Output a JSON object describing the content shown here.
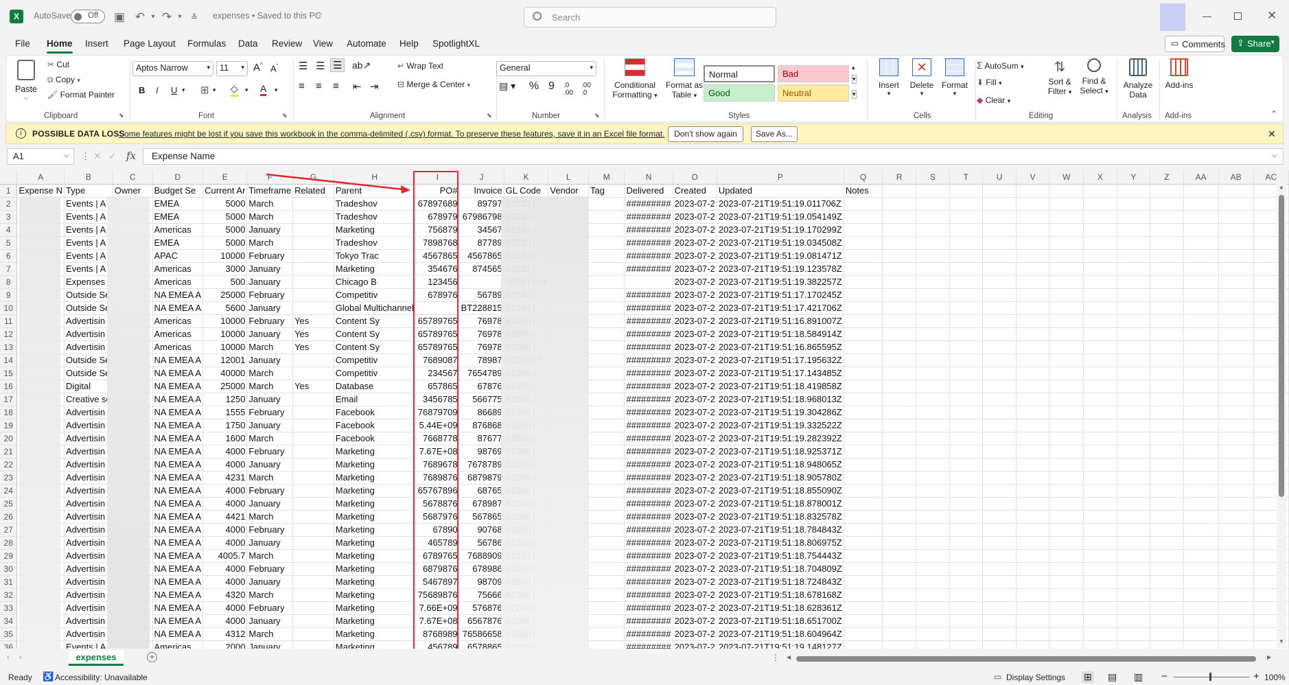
{
  "titlebar": {
    "autosave": "AutoSave",
    "toggle": "Off",
    "doc_title": "expenses • Saved to this PC",
    "search_placeholder": "Search"
  },
  "menu": [
    "File",
    "Home",
    "Insert",
    "Page Layout",
    "Formulas",
    "Data",
    "Review",
    "View",
    "Automate",
    "Help",
    "SpotlightXL"
  ],
  "menu_buttons": {
    "comments": "Comments",
    "share": "Share"
  },
  "ribbon": {
    "clipboard": {
      "paste": "Paste",
      "cut": "Cut",
      "copy": "Copy",
      "format_painter": "Format Painter",
      "group": "Clipboard"
    },
    "font": {
      "name": "Aptos Narrow",
      "size": "11",
      "group": "Font"
    },
    "alignment": {
      "wrap": "Wrap Text",
      "merge": "Merge & Center",
      "group": "Alignment"
    },
    "number": {
      "format": "General",
      "group": "Number"
    },
    "styles": {
      "cond1": "Conditional",
      "cond2": "Formatting",
      "fmt1": "Format as",
      "fmt2": "Table",
      "normal": "Normal",
      "bad": "Bad",
      "good": "Good",
      "neutral": "Neutral",
      "group": "Styles"
    },
    "cells": {
      "insert": "Insert",
      "delete": "Delete",
      "format": "Format",
      "group": "Cells"
    },
    "editing": {
      "autosum": "AutoSum",
      "fill": "Fill",
      "clear": "Clear",
      "sort1": "Sort &",
      "sort2": "Filter",
      "find1": "Find &",
      "find2": "Select",
      "group": "Editing"
    },
    "analysis": {
      "l1": "Analyze",
      "l2": "Data",
      "group": "Analysis"
    },
    "addins": {
      "label": "Add-ins",
      "group": "Add-ins"
    }
  },
  "infobar": {
    "title": "POSSIBLE DATA LOSS",
    "message": "Some features might be lost if you save this workbook in the comma-delimited (.csv) format. To preserve these features, save it in an Excel file format.",
    "btn1": "Don't show again",
    "btn2": "Save As..."
  },
  "formula": {
    "cell": "A1",
    "fx": "fx",
    "value": "Expense Name"
  },
  "columns": [
    "A",
    "B",
    "C",
    "D",
    "E",
    "F",
    "G",
    "H",
    "I",
    "J",
    "K",
    "L",
    "M",
    "N",
    "O",
    "P",
    "Q",
    "R",
    "S",
    "T",
    "U",
    "V",
    "W",
    "X",
    "Y",
    "Z",
    "AA",
    "AB",
    "AC"
  ],
  "header_row": [
    "Expense N",
    "Type",
    "Owner",
    "Budget Se",
    "Current Ar",
    "Timeframe",
    "Related",
    "Parent",
    "PO#",
    "Invoice",
    "GL Code",
    "Vendor",
    "Tag",
    "Delivered",
    "Created",
    "Updated",
    "Notes"
  ],
  "rows": [
    [
      "",
      "Events | A",
      "",
      "EMEA",
      "5000",
      "March",
      "",
      "Tradeshov",
      "67897689",
      "89797",
      "62230 |",
      "",
      "",
      "#########",
      "2023-07-2",
      "2023-07-21T19:51:19.011706Z"
    ],
    [
      "",
      "Events | A",
      "",
      "EMEA",
      "5000",
      "March",
      "",
      "Tradeshov",
      "678979",
      "67986798",
      "62230 |",
      "",
      "",
      "#########",
      "2023-07-2",
      "2023-07-21T19:51:19.054149Z"
    ],
    [
      "",
      "Events | A",
      "",
      "Americas",
      "5000",
      "January",
      "",
      "Marketing",
      "756879",
      "34567",
      "62230 |",
      "",
      "",
      "#########",
      "2023-07-2",
      "2023-07-21T19:51:19.170299Z"
    ],
    [
      "",
      "Events | A",
      "",
      "EMEA",
      "5000",
      "March",
      "",
      "Tradeshov",
      "7898768",
      "87789",
      "62230 |",
      "",
      "",
      "#########",
      "2023-07-2",
      "2023-07-21T19:51:19.034508Z"
    ],
    [
      "",
      "Events | A",
      "",
      "APAC",
      "10000",
      "February",
      "",
      "Tokyo Trac",
      "4567865",
      "4567865",
      "62230 |",
      "",
      "",
      "#########",
      "2023-07-2",
      "2023-07-21T19:51:19.081471Z"
    ],
    [
      "",
      "Events | A",
      "",
      "Americas",
      "3000",
      "January",
      "",
      "Marketing",
      "354676",
      "874565",
      "62230 |",
      "",
      "",
      "#########",
      "2023-07-2",
      "2023-07-21T19:51:19.123578Z"
    ],
    [
      "",
      "Expenses",
      "",
      "Americas",
      "500",
      "January",
      "",
      "Chicago B",
      "123456",
      "",
      "0000 | Def",
      "",
      "",
      "",
      "2023-07-2",
      "2023-07-21T19:51:19.382257Z"
    ],
    [
      "",
      "Outside Se",
      "",
      "NA EMEA A",
      "25000",
      "February",
      "",
      "Competitiv",
      "678976",
      "56789",
      "62240 |",
      "",
      "",
      "#########",
      "2023-07-2",
      "2023-07-21T19:51:17.170245Z"
    ],
    [
      "",
      "Outside Se",
      "",
      "NA EMEA A",
      "5600",
      "January",
      "",
      "Global Multichannel",
      "",
      "BT228815",
      "62240 |",
      "",
      "",
      "#########",
      "2023-07-2",
      "2023-07-21T19:51:17.421706Z"
    ],
    [
      "",
      "Advertisin",
      "",
      "Americas",
      "10000",
      "February",
      "Yes",
      "Content Sy",
      "65789765",
      "76978",
      "62260 |",
      "",
      "",
      "#########",
      "2023-07-2",
      "2023-07-21T19:51:16.891007Z"
    ],
    [
      "",
      "Advertisin",
      "",
      "Americas",
      "10000",
      "January",
      "Yes",
      "Content Sy",
      "65789765",
      "76978",
      "62260 |",
      "",
      "",
      "#########",
      "2023-07-2",
      "2023-07-21T19:51:18.584914Z"
    ],
    [
      "",
      "Advertisin",
      "",
      "Americas",
      "10000",
      "March",
      "Yes",
      "Content Sy",
      "65789765",
      "76978",
      "62260 |",
      "",
      "",
      "#########",
      "2023-07-2",
      "2023-07-21T19:51:16.865595Z"
    ],
    [
      "",
      "Outside Se",
      "",
      "NA EMEA A",
      "12001",
      "January",
      "",
      "Competitiv",
      "7689087",
      "78987",
      "62220 | Tr",
      "",
      "",
      "#########",
      "2023-07-2",
      "2023-07-21T19:51:17.195632Z"
    ],
    [
      "",
      "Outside Se",
      "",
      "NA EMEA A",
      "40000",
      "March",
      "",
      "Competitiv",
      "234567",
      "7654789",
      "62260 |",
      "",
      "",
      "#########",
      "2023-07-2",
      "2023-07-21T19:51:17.143485Z"
    ],
    [
      "",
      "Digital",
      "",
      "NA EMEA A",
      "25000",
      "March",
      "Yes",
      "Database",
      "657865",
      "67876",
      "62250 |",
      "",
      "",
      "#########",
      "2023-07-2",
      "2023-07-21T19:51:18.419858Z"
    ],
    [
      "",
      "Creative se",
      "",
      "NA EMEA A",
      "1250",
      "January",
      "",
      "Email",
      "3456785",
      "566775",
      "62260 |",
      "",
      "",
      "#########",
      "2023-07-2",
      "2023-07-21T19:51:18.968013Z"
    ],
    [
      "",
      "Advertisin",
      "",
      "NA EMEA A",
      "1555",
      "February",
      "",
      "Facebook",
      "76879709",
      "86689",
      "62260 |",
      "",
      "",
      "#########",
      "2023-07-2",
      "2023-07-21T19:51:19.304286Z"
    ],
    [
      "",
      "Advertisin",
      "",
      "NA EMEA A",
      "1750",
      "January",
      "",
      "Facebook",
      "5.44E+09",
      "876868",
      "62260 |",
      "",
      "",
      "#########",
      "2023-07-2",
      "2023-07-21T19:51:19.332522Z"
    ],
    [
      "",
      "Advertisin",
      "",
      "NA EMEA A",
      "1600",
      "March",
      "",
      "Facebook",
      "7668778",
      "87677",
      "62260 |",
      "",
      "",
      "#########",
      "2023-07-2",
      "2023-07-21T19:51:19.282392Z"
    ],
    [
      "",
      "Advertisin",
      "",
      "NA EMEA A",
      "4000",
      "February",
      "",
      "Marketing",
      "7.67E+08",
      "98769",
      "62260 |",
      "",
      "",
      "#########",
      "2023-07-2",
      "2023-07-21T19:51:18.925371Z"
    ],
    [
      "",
      "Advertisin",
      "",
      "NA EMEA A",
      "4000",
      "January",
      "",
      "Marketing",
      "7689678",
      "7678789",
      "62260 |",
      "",
      "",
      "#########",
      "2023-07-2",
      "2023-07-21T19:51:18.948065Z"
    ],
    [
      "",
      "Advertisin",
      "",
      "NA EMEA A",
      "4231",
      "March",
      "",
      "Marketing",
      "7689876",
      "6879879",
      "62260 |",
      "",
      "",
      "#########",
      "2023-07-2",
      "2023-07-21T19:51:18.905780Z"
    ],
    [
      "",
      "Advertisin",
      "",
      "NA EMEA A",
      "4000",
      "February",
      "",
      "Marketing",
      "65767896",
      "68765",
      "62260 |",
      "",
      "",
      "#########",
      "2023-07-2",
      "2023-07-21T19:51:18.855090Z"
    ],
    [
      "",
      "Advertisin",
      "",
      "NA EMEA A",
      "4000",
      "January",
      "",
      "Marketing",
      "5678876",
      "678987",
      "62260 |",
      "",
      "",
      "#########",
      "2023-07-2",
      "2023-07-21T19:51:18.878001Z"
    ],
    [
      "",
      "Advertisin",
      "",
      "NA EMEA A",
      "4421",
      "March",
      "",
      "Marketing",
      "5687976",
      "567865",
      "62260 |",
      "",
      "",
      "#########",
      "2023-07-2",
      "2023-07-21T19:51:18.832578Z"
    ],
    [
      "",
      "Advertisin",
      "",
      "NA EMEA A",
      "4000",
      "February",
      "",
      "Marketing",
      "67890",
      "90768",
      "62260 |",
      "",
      "",
      "#########",
      "2023-07-2",
      "2023-07-21T19:51:18.784843Z"
    ],
    [
      "",
      "Advertisin",
      "",
      "NA EMEA A",
      "4000",
      "January",
      "",
      "Marketing",
      "465789",
      "56786",
      "62260 |",
      "",
      "",
      "#########",
      "2023-07-2",
      "2023-07-21T19:51:18.806975Z"
    ],
    [
      "",
      "Advertisin",
      "",
      "NA EMEA A",
      "4005.7",
      "March",
      "",
      "Marketing",
      "6789765",
      "7688909",
      "62260 |",
      "",
      "",
      "#########",
      "2023-07-2",
      "2023-07-21T19:51:18.754443Z"
    ],
    [
      "",
      "Advertisin",
      "",
      "NA EMEA A",
      "4000",
      "February",
      "",
      "Marketing",
      "6879876",
      "678986",
      "62260 |",
      "",
      "",
      "#########",
      "2023-07-2",
      "2023-07-21T19:51:18.704809Z"
    ],
    [
      "",
      "Advertisin",
      "",
      "NA EMEA A",
      "4000",
      "January",
      "",
      "Marketing",
      "5467897",
      "98709",
      "62260 |",
      "",
      "",
      "#########",
      "2023-07-2",
      "2023-07-21T19:51:18.724843Z"
    ],
    [
      "",
      "Advertisin",
      "",
      "NA EMEA A",
      "4320",
      "March",
      "",
      "Marketing",
      "75689876",
      "75666",
      "62260 |",
      "",
      "",
      "#########",
      "2023-07-2",
      "2023-07-21T19:51:18.678168Z"
    ],
    [
      "",
      "Advertisin",
      "",
      "NA EMEA A",
      "4000",
      "February",
      "",
      "Marketing",
      "7.66E+09",
      "576876",
      "62260 |",
      "",
      "",
      "#########",
      "2023-07-2",
      "2023-07-21T19:51:18.628361Z"
    ],
    [
      "",
      "Advertisin",
      "",
      "NA EMEA A",
      "4000",
      "January",
      "",
      "Marketing",
      "7.67E+08",
      "6567876",
      "62260 |",
      "",
      "",
      "#########",
      "2023-07-2",
      "2023-07-21T19:51:18.651700Z"
    ],
    [
      "",
      "Advertisin",
      "",
      "NA EMEA A",
      "4312",
      "March",
      "",
      "Marketing",
      "8768989",
      "76586658",
      "62260 |",
      "",
      "",
      "#########",
      "2023-07-2",
      "2023-07-21T19:51:18.604964Z"
    ],
    [
      "",
      "Events | A",
      "",
      "Americas",
      "2000",
      "January",
      "",
      "Marketing",
      "456789",
      "6578865",
      "62230 |",
      "",
      "",
      "#########",
      "2023-07-2",
      "2023-07-21T19:51:19.148127Z"
    ]
  ],
  "sheet_tab": "expenses",
  "status": {
    "ready": "Ready",
    "accessibility": "Accessibility: Unavailable",
    "display": "Display Settings",
    "zoom": "100%"
  },
  "colors": {
    "accent": "#107c41",
    "highlight": "#e0282e"
  }
}
